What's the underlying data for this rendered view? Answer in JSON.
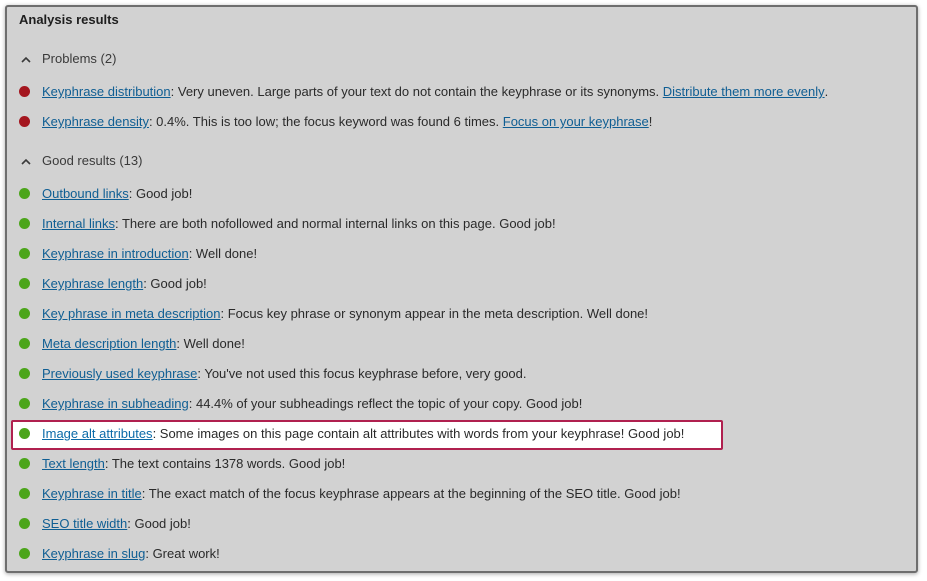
{
  "panel": {
    "title": "Analysis results"
  },
  "problems": {
    "header": "Problems (2)",
    "items": [
      {
        "link": "Keyphrase distribution",
        "text": ": Very uneven. Large parts of your text do not contain the keyphrase or its synonyms. ",
        "action": "Distribute them more evenly",
        "tail": "."
      },
      {
        "link": "Keyphrase density",
        "text": ": 0.4%. This is too low; the focus keyword was found 6 times. ",
        "action": "Focus on your keyphrase",
        "tail": "!"
      }
    ]
  },
  "good": {
    "header": "Good results (13)",
    "items": [
      {
        "link": "Outbound links",
        "text": ": Good job!"
      },
      {
        "link": "Internal links",
        "text": ": There are both nofollowed and normal internal links on this page. Good job!"
      },
      {
        "link": "Keyphrase in introduction",
        "text": ": Well done!"
      },
      {
        "link": "Keyphrase length",
        "text": ": Good job!"
      },
      {
        "link": "Key phrase in meta description",
        "text": ": Focus key phrase or synonym appear in the meta description. Well done!"
      },
      {
        "link": "Meta description length",
        "text": ": Well done!"
      },
      {
        "link": "Previously used keyphrase",
        "text": ": You've not used this focus keyphrase before, very good."
      },
      {
        "link": "Keyphrase in subheading",
        "text": ": 44.4% of your subheadings reflect the topic of your copy. Good job!"
      },
      {
        "link": "Image alt attributes",
        "text": ": Some images on this page contain alt attributes with words from your keyphrase! Good job!"
      },
      {
        "link": "Text length",
        "text": ": The text contains 1378 words. Good job!"
      },
      {
        "link": "Keyphrase in title",
        "text": ": The exact match of the focus keyphrase appears at the beginning of the SEO title. Good job!"
      },
      {
        "link": "SEO title width",
        "text": ": Good job!"
      },
      {
        "link": "Keyphrase in slug",
        "text": ": Great work!"
      }
    ]
  },
  "colors": {
    "problem_bullet": "#a4161f",
    "good_bullet": "#4ca51b",
    "link": "#0f5e93",
    "highlight_border": "#b0204f"
  }
}
